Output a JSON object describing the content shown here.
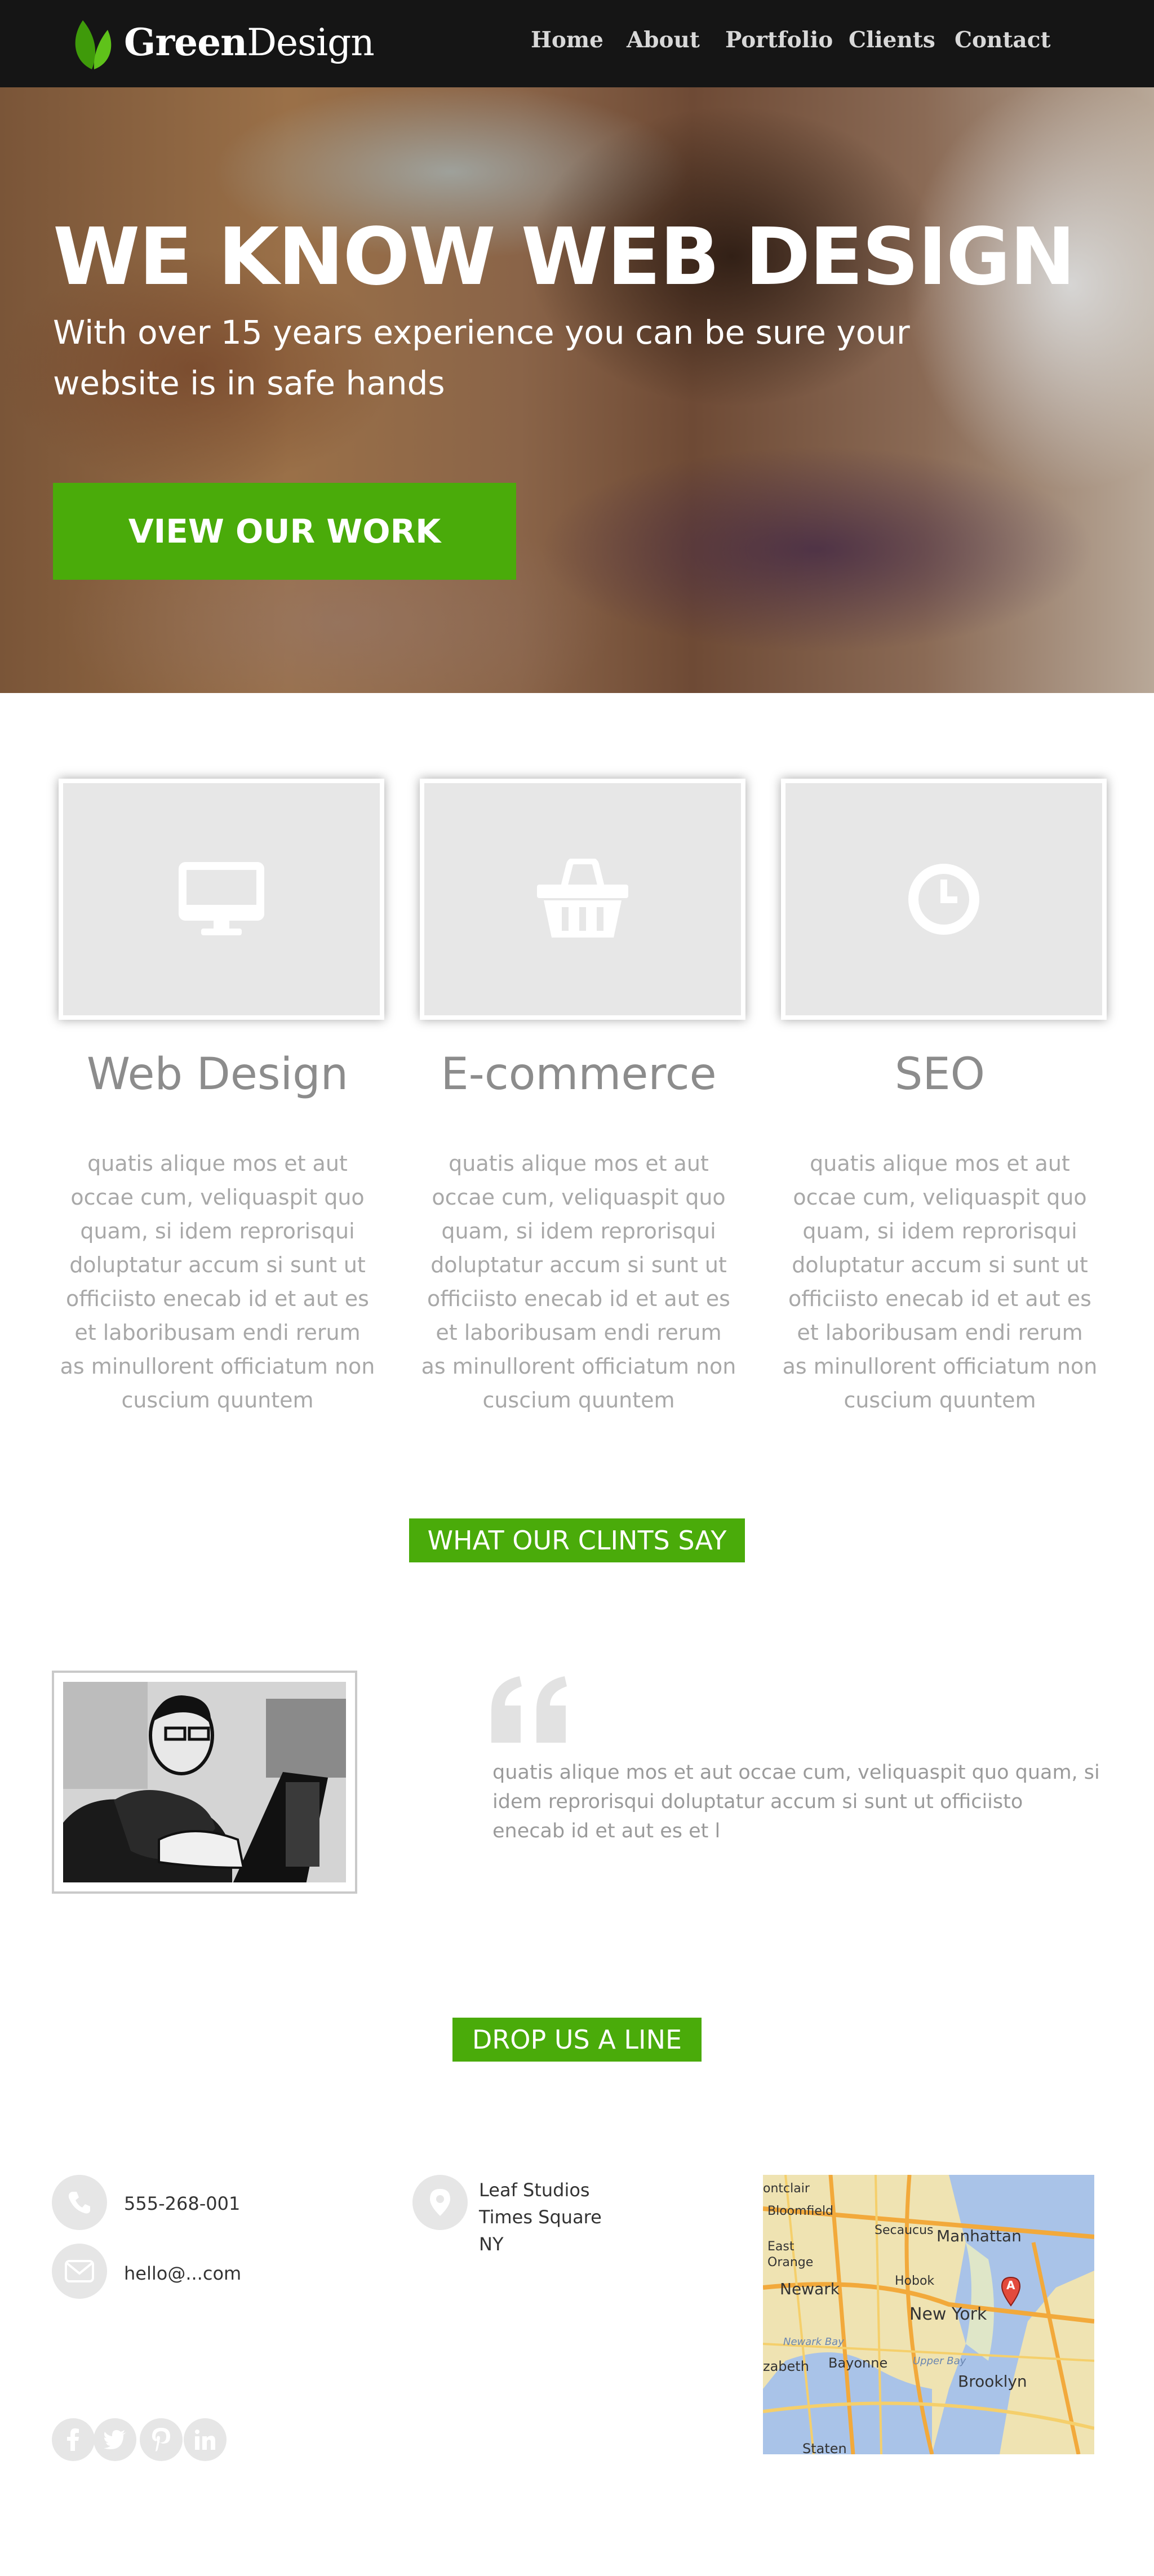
{
  "header": {
    "brand_strong": "Green",
    "brand_light": "Design",
    "nav": [
      "Home",
      "About",
      "Portfolio",
      "Clients",
      "Contact"
    ]
  },
  "hero": {
    "title": "WE KNOW WEB DESIGN",
    "subtitle": "With over 15 years experience you can be sure your website is in safe hands",
    "cta_label": "VIEW OUR WORK"
  },
  "services": [
    {
      "title": "Web Design",
      "icon": "monitor-icon",
      "text": "quatis alique mos et aut occae cum, veliquaspit quo quam, si idem reprorisqui doluptatur accum si sunt ut officiisto enecab id et aut es et laboribusam endi rerum as minullorent officiatum non cuscium quuntem"
    },
    {
      "title": "E-commerce",
      "icon": "basket-icon",
      "text": "quatis alique mos et aut occae cum, veliquaspit quo quam, si idem reprorisqui doluptatur accum si sunt ut officiisto enecab id et aut es et laboribusam endi rerum as minullorent officiatum non cuscium quuntem"
    },
    {
      "title": "SEO",
      "icon": "clock-icon",
      "text": "quatis alique mos et aut occae cum, veliquaspit quo quam, si idem reprorisqui doluptatur accum si sunt ut officiisto enecab id et aut es et laboribusam endi rerum as minullorent officiatum non cuscium quuntem"
    }
  ],
  "testimonials": {
    "heading": "WHAT OUR CLINTS SAY",
    "quote": "quatis alique mos et aut occae cum, veliquaspit quo quam, si idem reprorisqui doluptatur accum si sunt ut officiisto enecab id et aut es et l"
  },
  "contact": {
    "heading": "DROP US A LINE",
    "phone": "555-268-001",
    "email": "hello@...com",
    "address": [
      "Leaf Studios",
      "Times Square",
      "NY"
    ],
    "map_labels": [
      "ontclair",
      "Bloomfield",
      "Secaucus",
      "Manhattan",
      "East Orange",
      "Newark",
      "Hobok",
      "New York",
      "Newark Bay",
      "Bayonne",
      "Upper Bay",
      "Brooklyn",
      "zabeth",
      "Staten",
      "A"
    ],
    "social": [
      "facebook-icon",
      "twitter-icon",
      "pinterest-icon",
      "linkedin-icon"
    ]
  },
  "colors": {
    "accent": "#4aab0a",
    "header_bg": "#151515",
    "card_bg": "#e7e7e7",
    "muted_text": "#8c8c8c"
  }
}
